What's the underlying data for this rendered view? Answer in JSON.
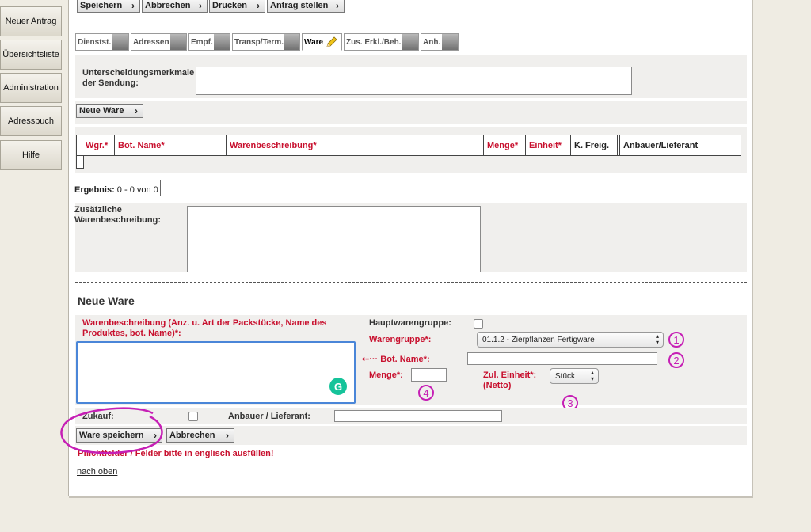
{
  "sidebar": {
    "items": [
      {
        "label": "Neuer Antrag"
      },
      {
        "label": "Übersichtsliste"
      },
      {
        "label": "Administration"
      },
      {
        "label": "Adressbuch"
      },
      {
        "label": "Hilfe"
      }
    ]
  },
  "toolbar": {
    "save": "Speichern",
    "cancel": "Abbrechen",
    "print": "Drucken",
    "submit": "Antrag stellen"
  },
  "tabs": [
    {
      "label": "Dienstst."
    },
    {
      "label": "Adressen"
    },
    {
      "label": "Empf."
    },
    {
      "label": "Transp/Term."
    },
    {
      "label": "Ware"
    },
    {
      "label": "Zus. Erkl./Beh."
    },
    {
      "label": "Anh."
    }
  ],
  "shipment": {
    "label": "Unterscheidungsmerkmale der Sendung:",
    "value": ""
  },
  "new_item_button": "Neue Ware",
  "table": {
    "columns": [
      "Wgr.*",
      "Bot. Name*",
      "Warenbeschreibung*",
      "Menge*",
      "Einheit*",
      "K. Freig.",
      "",
      "Anbauer/Lieferant"
    ]
  },
  "result": {
    "label": "Ergebnis:",
    "value": "0 - 0 von 0"
  },
  "extra_desc": {
    "label": "Zusätzliche Warenbeschreibung:",
    "value": ""
  },
  "form": {
    "heading": "Neue Ware",
    "desc_label": "Warenbeschreibung (Anz. u. Art der Packstücke, Name des Produktes, bot. Name)*:",
    "main_group_label": "Hauptwarengruppe:",
    "group_label": "Warengruppe*:",
    "group_value": "01.1.2 - Zierpflanzen Fertigware",
    "bot_label": "Bot. Name*:",
    "bot_value": "",
    "qty_label": "Menge*:",
    "qty_value": "",
    "unit_label": "Zul. Einheit*:",
    "unit_sub": "(Netto)",
    "unit_value": "Stück",
    "purchase_label": "Zukauf:",
    "grower_label": "Anbauer / Lieferant:",
    "grower_value": "",
    "save_item": "Ware speichern",
    "cancel_item": "Abbrechen",
    "note": "Pflichtfelder / Felder bitte in englisch ausfüllen!",
    "top_link": "nach oben",
    "grammarly_icon_text": "G"
  },
  "annotations": [
    "1",
    "2",
    "3",
    "4"
  ],
  "colors": {
    "required_red": "#c8102e",
    "annotation_magenta": "#c61fb5",
    "focus_blue": "#4a86d8",
    "grammarly_green": "#15c39a"
  }
}
